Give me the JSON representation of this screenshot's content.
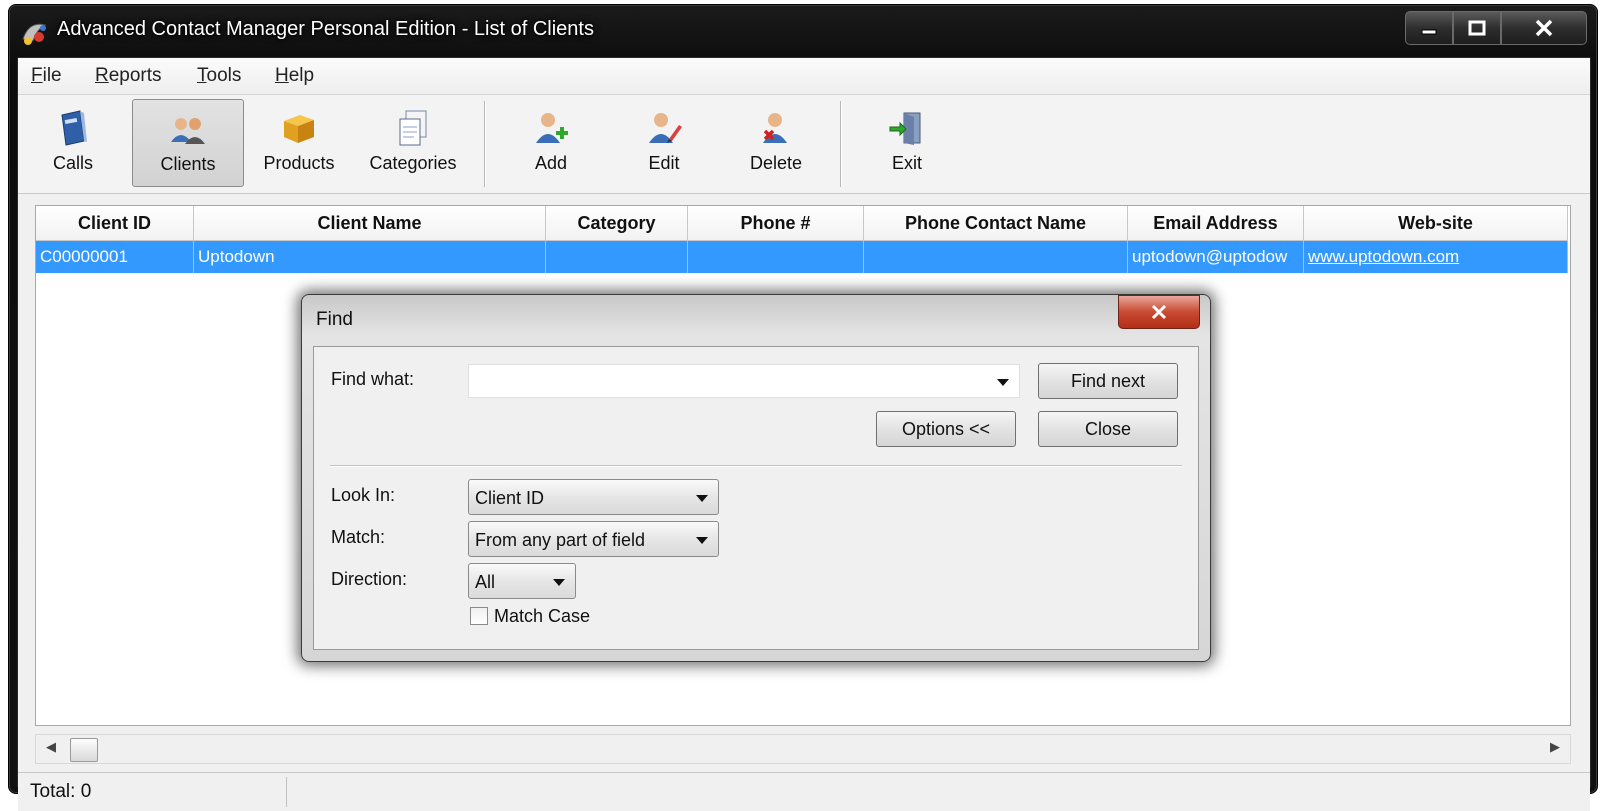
{
  "window": {
    "title": "Advanced Contact Manager Personal Edition - List of Clients"
  },
  "menu": [
    "File",
    "Reports",
    "Tools",
    "Help"
  ],
  "toolbar": {
    "buttons": [
      "Calls",
      "Clients",
      "Products",
      "Categories",
      "Add",
      "Edit",
      "Delete",
      "Exit"
    ],
    "active": "Clients"
  },
  "grid": {
    "columns": [
      "Client ID",
      "Client Name",
      "Category",
      "Phone #",
      "Phone Contact Name",
      "Email Address",
      "Web-site"
    ],
    "rows": [
      [
        "C00000001",
        "Uptodown",
        "",
        "",
        "",
        "uptodown@uptodow",
        "www.uptodown.com"
      ]
    ]
  },
  "status": {
    "total": "Total: 0"
  },
  "find_dialog": {
    "title": "Find",
    "find_what_label": "Find what:",
    "find_what_value": "",
    "find_next": "Find next",
    "options": "Options <<",
    "close": "Close",
    "look_in_label": "Look In:",
    "look_in_value": "Client ID",
    "match_label": "Match:",
    "match_value": "From any part of field",
    "direction_label": "Direction:",
    "direction_value": "All",
    "match_case_label": "Match Case",
    "match_case_checked": false
  },
  "colors": {
    "selection": "#3399ff",
    "dialog_close": "#c94a32"
  }
}
